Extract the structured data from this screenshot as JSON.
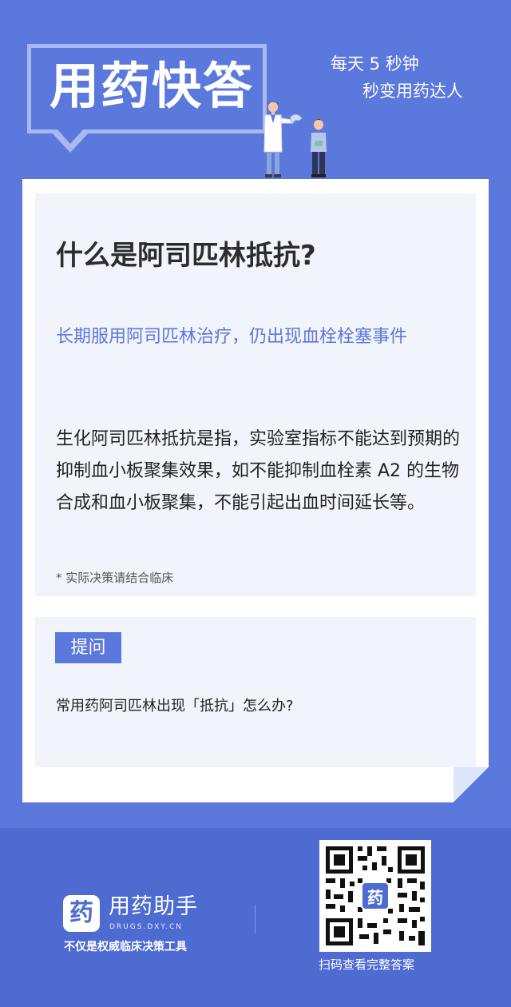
{
  "header": {
    "title": "用药快答",
    "slogan_line1": "每天 5 秒钟",
    "slogan_line2": "秒变用药达人"
  },
  "question": {
    "title": "什么是阿司匹林抵抗?",
    "subtitle": "长期服用阿司匹林治疗，仍出现血栓栓塞事件",
    "body": "生化阿司匹林抵抗是指，实验室指标不能达到预期的抑制血小板聚集效果，如不能抑制血栓素 A2 的生物合成和血小板聚集，不能引起出血时间延长等。",
    "note": "* 实际决策请结合临床"
  },
  "ask": {
    "tag": "提问",
    "text": "常用药阿司匹林出现「抵抗」怎么办?"
  },
  "footer": {
    "logo_char": "药",
    "brand_name": "用药助手",
    "brand_domain": "DRUGS.DXY.CN",
    "brand_tagline": "不仅是权威临床决策工具",
    "qr_center_char": "药",
    "qr_caption": "扫码查看完整答案"
  },
  "colors": {
    "background": "#5b78dd",
    "accent": "#5b78dd",
    "panel": "#f2f4fb",
    "footer": "#4e6bd1"
  }
}
